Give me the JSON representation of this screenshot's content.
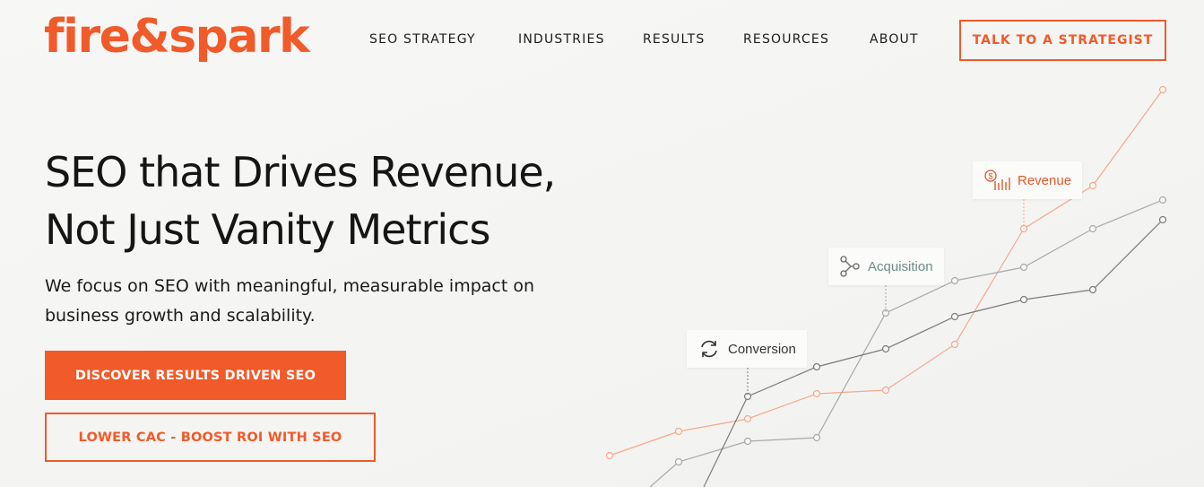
{
  "brand": {
    "logo_text": "fire&spark",
    "accent_color": "#f15a29"
  },
  "nav": {
    "items": [
      {
        "label": "SEO STRATEGY"
      },
      {
        "label": "INDUSTRIES"
      },
      {
        "label": "RESULTS"
      },
      {
        "label": "RESOURCES"
      },
      {
        "label": "ABOUT"
      }
    ],
    "cta_label": "TALK TO A STRATEGIST"
  },
  "hero": {
    "title_line1": "SEO that Drives Revenue,",
    "title_line2": "Not Just Vanity Metrics",
    "subtitle": "We focus on SEO with meaningful, measurable impact on business growth and scalability.",
    "primary_button": "DISCOVER RESULTS DRIVEN SEO",
    "secondary_button": "LOWER CAC - BOOST ROI WITH SEO"
  },
  "graphic": {
    "labels": [
      {
        "text": "Conversion",
        "icon": "refresh-cycle-icon",
        "color": "#333333"
      },
      {
        "text": "Acquisition",
        "icon": "nodes-icon",
        "color": "#6b8d87"
      },
      {
        "text": "Revenue",
        "icon": "dollar-bars-icon",
        "color": "#e05a2b"
      }
    ],
    "line_colors": {
      "revenue": "#f5a88d",
      "acquisition": "#a9a9a9",
      "conversion": "#7b7b7b"
    }
  }
}
